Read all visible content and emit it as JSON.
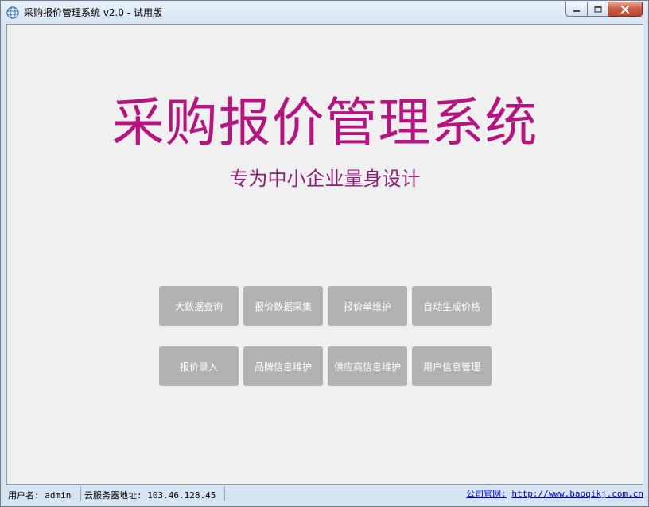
{
  "window": {
    "title": "采购报价管理系统  v2.0  - 试用版"
  },
  "main": {
    "title": "采购报价管理系统",
    "subtitle": "专为中小企业量身设计"
  },
  "buttons": [
    {
      "label": "大数据查询"
    },
    {
      "label": "报价数据采集"
    },
    {
      "label": "报价单维护"
    },
    {
      "label": "自动生成价格"
    },
    {
      "label": "报价录入"
    },
    {
      "label": "品牌信息维护"
    },
    {
      "label": "供应商信息维护"
    },
    {
      "label": "用户信息管理"
    }
  ],
  "statusbar": {
    "user": "用户名: admin",
    "server": "云服务器地址: 103.46.128.45",
    "site_label": "公司官网:",
    "site_url": "http://www.baoqikj.com.cn"
  },
  "colors": {
    "title": "#b4157f",
    "subtitle": "#8a1f73",
    "button_bg": "#b2b2b2",
    "client_bg": "#f0f0f0"
  },
  "icons": {
    "app": "globe-icon",
    "minimize": "minimize-icon",
    "maximize": "maximize-icon",
    "close": "close-icon"
  }
}
